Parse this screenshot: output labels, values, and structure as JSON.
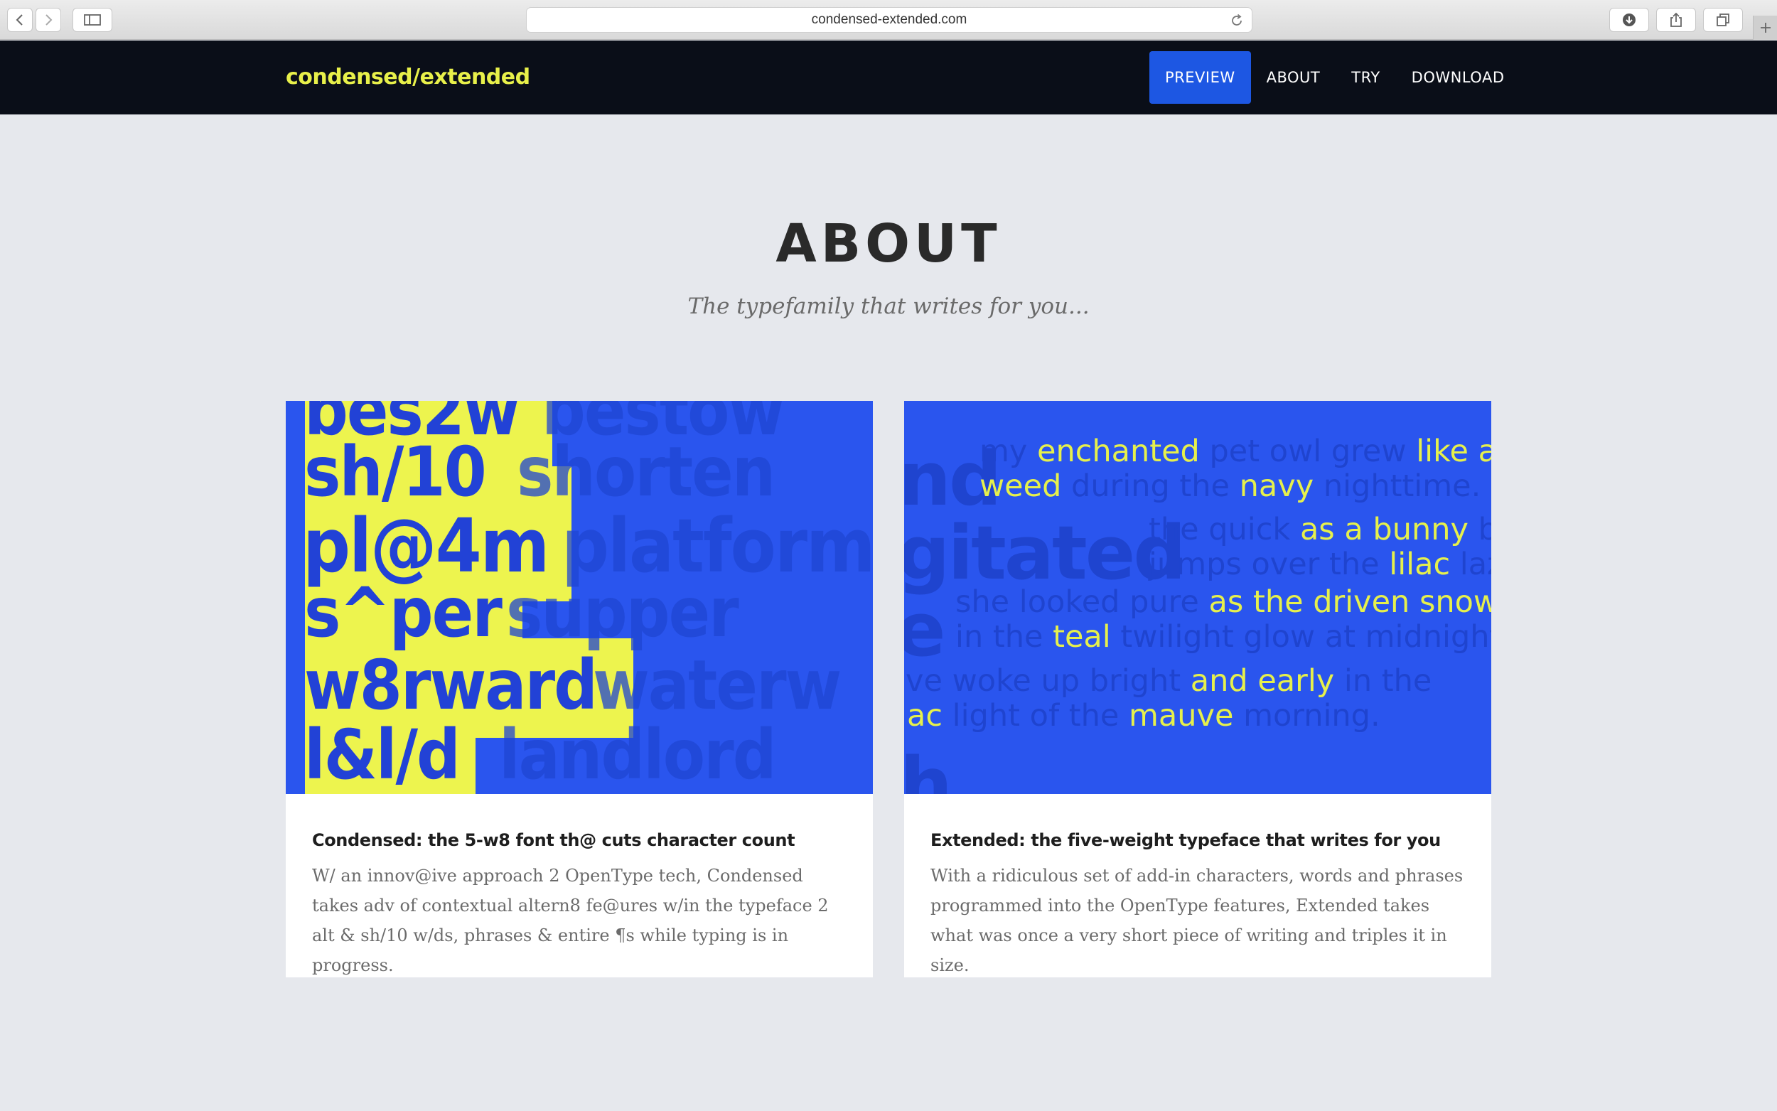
{
  "browser": {
    "url": "condensed-extended.com",
    "icons": [
      "back-icon",
      "forward-icon",
      "sidebar-icon",
      "reload-icon",
      "download-icon",
      "share-icon",
      "tabs-icon",
      "plus-icon"
    ]
  },
  "nav": {
    "brand": "condensed/extended",
    "links": [
      {
        "label": "PREVIEW",
        "active": true
      },
      {
        "label": "ABOUT",
        "active": false
      },
      {
        "label": "TRY",
        "active": false
      },
      {
        "label": "DOWNLOAD",
        "active": false
      }
    ]
  },
  "about": {
    "title": "ABOUT",
    "subtitle": "The typefamily that writes for you..."
  },
  "cards": [
    {
      "title": "Condensed: the 5-w8 font th@ cuts character count",
      "text": "W/ an innov@ive approach 2 OpenType tech, Condensed takes adv of contextual altern8 fe@ures w/in the typeface 2 alt & sh/10 w/ds, phrases & entire ¶s while typing is in progress.",
      "art": {
        "short": [
          "bes2w",
          "sh/10",
          "pl@4m",
          "s^per",
          "w8rward",
          "l&l/d"
        ],
        "long": [
          "bestow",
          "shorten",
          "platform",
          "supper",
          "waterw",
          "landlord"
        ]
      }
    },
    {
      "title": "Extended: the five-weight typeface that writes for you",
      "text": "With a ridiculous set of add-in characters, words and phrases programmed into the OpenType features, Extended takes what was once a very short piece of writing and triples it in size.",
      "art": {
        "big": [
          "nd",
          "gitated",
          "e",
          "h"
        ],
        "lines": [
          [
            [
              "b",
              "my "
            ],
            [
              "y",
              "enchanted"
            ],
            [
              "b",
              " pet owl grew "
            ],
            [
              "y",
              "like a"
            ]
          ],
          [
            [
              "y",
              "weed"
            ],
            [
              "b",
              " during the "
            ],
            [
              "y",
              "navy"
            ],
            [
              "b",
              " nighttime."
            ]
          ],
          [
            [
              "b",
              "the quick "
            ],
            [
              "y",
              "as a bunny"
            ],
            [
              "b",
              " bro"
            ]
          ],
          [
            [
              "b",
              "jumps over the "
            ],
            [
              "y",
              "lilac"
            ],
            [
              "b",
              " lazy"
            ]
          ],
          [
            [
              "b",
              "she looked pure "
            ],
            [
              "y",
              "as the driven snow"
            ]
          ],
          [
            [
              "b",
              "in the "
            ],
            [
              "y",
              "teal"
            ],
            [
              "b",
              " twilight glow at midnight"
            ]
          ],
          [
            [
              "b",
              "ve woke up bright "
            ],
            [
              "y",
              "and early"
            ],
            [
              "b",
              " in the"
            ]
          ],
          [
            [
              "y",
              "ac"
            ],
            [
              "b",
              " light of the "
            ],
            [
              "y",
              "mauve"
            ],
            [
              "b",
              " morning."
            ]
          ]
        ]
      }
    }
  ]
}
